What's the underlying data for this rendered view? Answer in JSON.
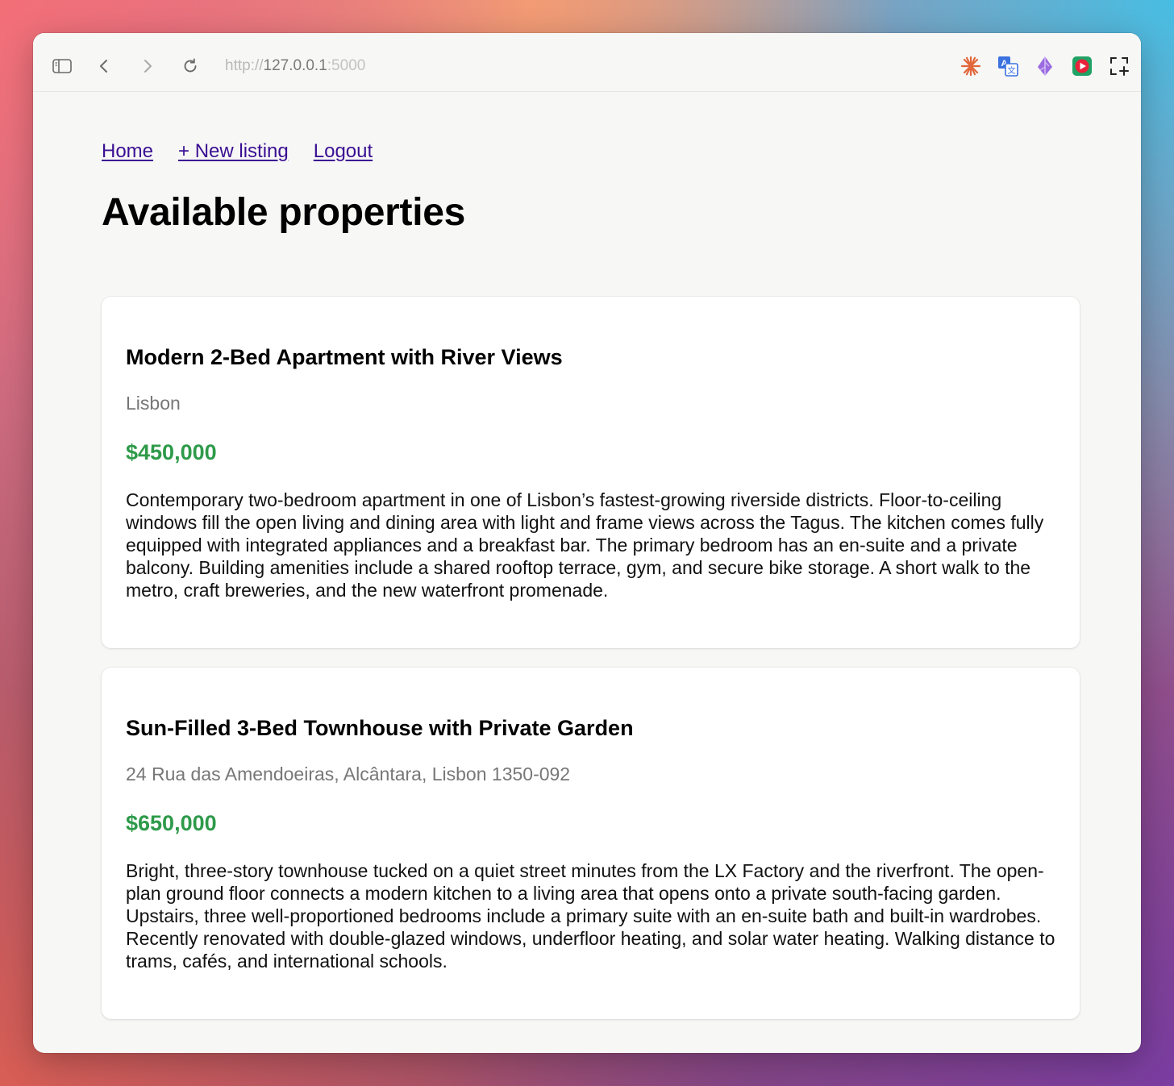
{
  "browser": {
    "url_scheme": "http://",
    "url_host": "127.0.0.1",
    "url_port": ":5000",
    "icons": [
      "sidebar-icon",
      "back-icon",
      "forward-icon",
      "reload-icon",
      "sparkle-extension-icon",
      "translate-extension-icon",
      "feather-extension-icon",
      "play-extension-icon",
      "screenshot-add-icon"
    ]
  },
  "nav": {
    "home": "Home",
    "new_listing": "+ New listing",
    "logout": "Logout"
  },
  "page": {
    "title": "Available properties"
  },
  "listings": [
    {
      "title": "Modern 2-Bed Apartment with River Views",
      "location": "Lisbon",
      "price": "$450,000",
      "description": "Contemporary two-bedroom apartment in one of Lisbon’s fastest-growing riverside districts. Floor-to-ceiling windows fill the open living and dining area with light and frame views across the Tagus. The kitchen comes fully equipped with integrated appliances and a breakfast bar. The primary bedroom has an en-suite and a private balcony. Building amenities include a shared rooftop terrace, gym, and secure bike storage. A short walk to the metro, craft breweries, and the new waterfront promenade."
    },
    {
      "title": "Sun-Filled 3-Bed Townhouse with Private Garden",
      "location": "24 Rua das Amendoeiras, Alcântara, Lisbon 1350-092",
      "price": "$650,000",
      "description": "Bright, three-story townhouse tucked on a quiet street minutes from the LX Factory and the riverfront. The open-plan ground floor connects a modern kitchen to a living area that opens onto a private south-facing garden. Upstairs, three well-proportioned bedrooms include a primary suite with an en-suite bath and built-in wardrobes. Recently renovated with double-glazed windows, underfloor heating, and solar water heating. Walking distance to trams, cafés, and international schools."
    }
  ],
  "colors": {
    "link": "#3a0f92",
    "price": "#2e9a4a",
    "location": "#777777"
  }
}
